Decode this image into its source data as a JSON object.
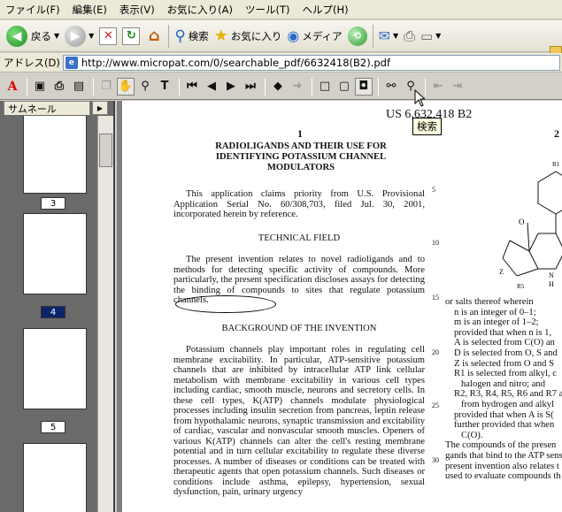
{
  "menu": [
    "ファイル(F)",
    "編集(E)",
    "表示(V)",
    "お気に入り(A)",
    "ツール(T)",
    "ヘルプ(H)"
  ],
  "toolbar": {
    "back_label": "戻る",
    "search_label": "検索",
    "favorites_label": "お気に入り",
    "media_label": "メディア"
  },
  "address": {
    "label": "アドレス(D)",
    "url": "http://www.micropat.com/0/searchable_pdf/6632418(B2).pdf"
  },
  "tooltip": "検索",
  "thumbnails": {
    "tab_label": "サムネール",
    "pages": [
      {
        "label": "3",
        "selected": false
      },
      {
        "label": "4",
        "selected": true
      },
      {
        "label": "5",
        "selected": false
      }
    ]
  },
  "document": {
    "header": "US 6,632,418 B2",
    "col1_number": "1",
    "col2_number": "2",
    "title_lines": [
      "RADIOLIGANDS AND THEIR USE FOR",
      "IDENTIFYING POTASSIUM CHANNEL",
      "MODULATORS"
    ],
    "priority_para": "This application claims priority from U.S. Provisional Application Serial No. 60/308,703, filed Jul. 30, 2001, incorporated herein by reference.",
    "tech_heading": "TECHNICAL FIELD",
    "tech_para": "The present invention relates to novel radioligands and to methods for detecting specific activity of compounds. More particularly, the present specification discloses assays for detecting the binding of compounds to sites that regulate potassium channels.",
    "bg_heading": "BACKGROUND OF THE INVENTION",
    "bg_para": "Potassium channels play important roles in regulating cell membrane excitability. In particular, ATP-sensitive potassium channels that are inhibited by intracellular ATP link cellular metabolism with membrane excitability in various cell types including cardiac, smooth muscle, neurons and secretory cells. In these cell types, K(ATP) channels modulate physiological processes including insulin secretion from pancreas, leptin release from hypothalamic neurons, synaptic transmission and excitability of cardiac, vascular and nonvascular smooth muscles. Openers of various K(ATP) channels can alter the cell's resting membrane potential and in turn cellular excitability to regulate these diverse processes. A number of diseases or conditions can be treated with therapeutic agents that open potassium channels. Such diseases or conditions include asthma, epilepsy, hypertension, sexual dysfunction, pain, urinary urgency",
    "line_numbers": [
      "5",
      "10",
      "15",
      "20",
      "25",
      "30"
    ],
    "col2_lines": [
      "or salts thereof wherein",
      "n is an integer of 0–1;",
      "m is an integer of 1–2;",
      "provided that when n is 1,",
      "A is selected from C(O) an",
      "D is selected from O, S and",
      "Z is selected from O and S",
      "R1 is selected from alkyl, c",
      "halogen and nitro; and",
      "R2, R3, R4, R5, R6 and R7 ar",
      "from hydrogen and alkyl",
      "provided that when A is S(",
      "further provided that when",
      "C(O).",
      "The compounds of the presen",
      "gands that bind to the ATP sens",
      "present invention also relates t",
      "used to evaluate compounds th"
    ],
    "structure_labels": {
      "r1": "R1",
      "o": "O",
      "z": "Z",
      "r5": "R5",
      "h": "H",
      "n": "N"
    }
  }
}
